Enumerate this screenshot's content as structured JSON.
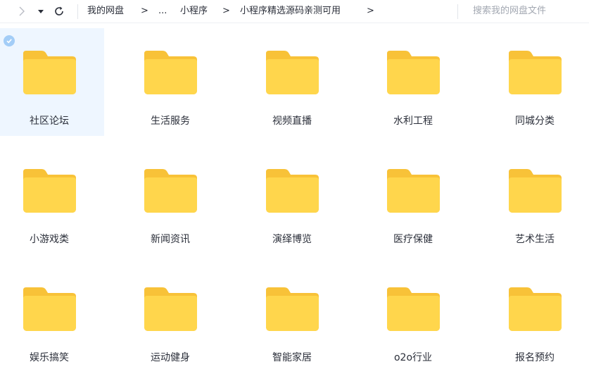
{
  "breadcrumb": {
    "items": [
      "我的网盘",
      "...",
      "小程序",
      "小程序精选源码亲测可用"
    ],
    "separator": ">"
  },
  "search": {
    "placeholder": "搜索我的网盘文件"
  },
  "colors": {
    "folder_back": "#f8c238",
    "folder_front": "#ffd64c",
    "selected_bg": "#eef6ff",
    "check_bg": "#a3cdf7"
  },
  "folders": [
    {
      "name": "社区论坛",
      "selected": true
    },
    {
      "name": "生活服务"
    },
    {
      "name": "视频直播"
    },
    {
      "name": "水利工程"
    },
    {
      "name": "同城分类"
    },
    {
      "name": "小游戏类"
    },
    {
      "name": "新闻资讯"
    },
    {
      "name": "演绎博览"
    },
    {
      "name": "医疗保健"
    },
    {
      "name": "艺术生活"
    },
    {
      "name": "娱乐搞笑"
    },
    {
      "name": "运动健身"
    },
    {
      "name": "智能家居"
    },
    {
      "name": "o2o行业"
    },
    {
      "name": "报名预约"
    }
  ]
}
